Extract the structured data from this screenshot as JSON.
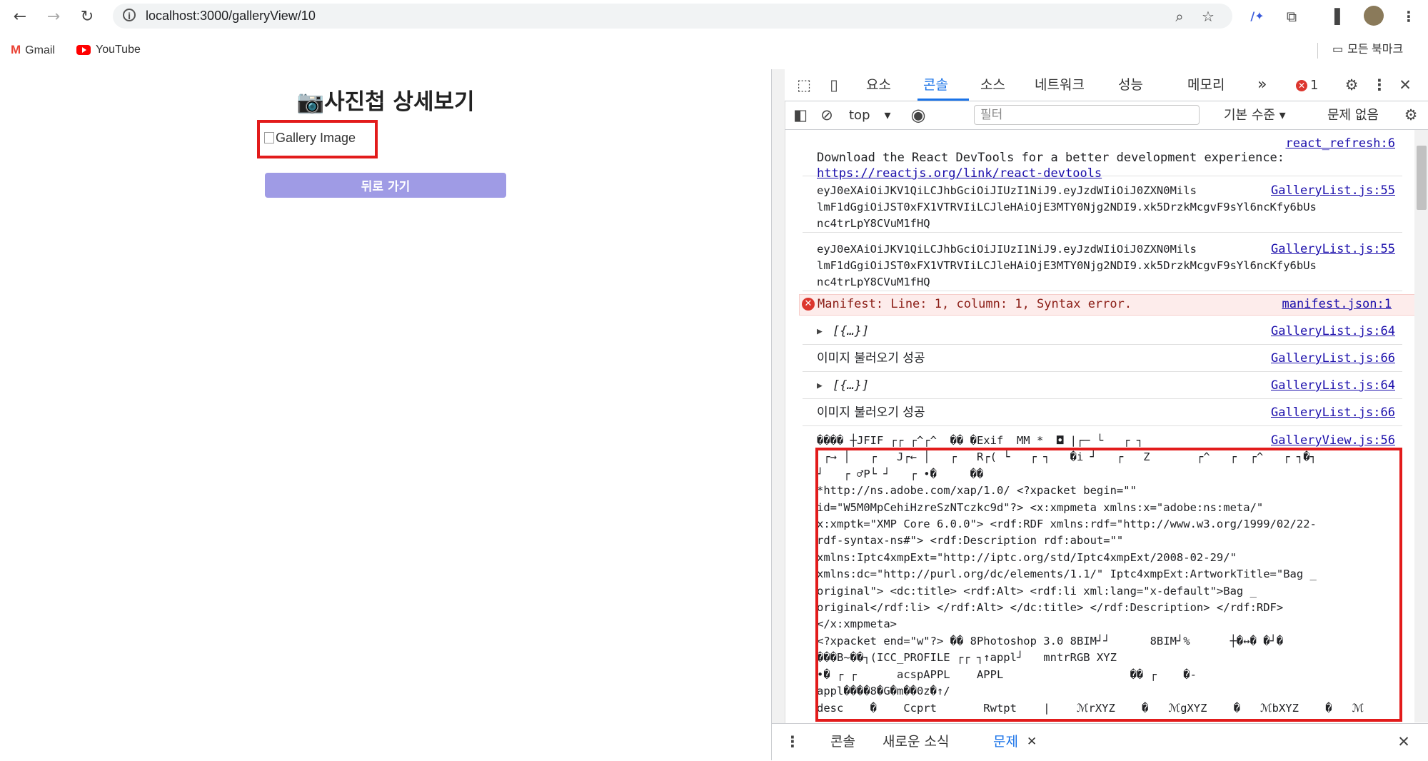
{
  "browser": {
    "url": "localhost:3000/galleryView/10",
    "bookmarks": [
      {
        "label": "Gmail",
        "icon": "gmail-icon"
      },
      {
        "label": "YouTube",
        "icon": "youtube-icon"
      }
    ],
    "all_bookmarks_label": "모든 북마크"
  },
  "page": {
    "title": "📷사진첩 상세보기",
    "image_alt": "Gallery Image",
    "back_button": "뒤로 가기"
  },
  "devtools": {
    "tabs": [
      "요소",
      "콘솔",
      "소스",
      "네트워크",
      "성능",
      "메모리"
    ],
    "active_tab": "콘솔",
    "more_tabs": "»",
    "error_count": "1",
    "context": "top",
    "filter_placeholder": "필터",
    "level": "기본 수준 ▾",
    "issues": "문제 없음",
    "console": {
      "react_src": "react_refresh:6",
      "react_line1": "Download the React DevTools for a better development experience:",
      "react_link": "https://reactjs.org/link/react-devtools",
      "token1_line1": "eyJ0eXAiOiJKV1QiLCJhbGciOiJIUzI1NiJ9.eyJzdWIiOiJ0ZXN0Mils",
      "token1_line2": "lmF1dGgiOiJST0xFX1VTRVIiLCJleHAiOjE3MTY0Njg2NDI9.xk5DrzkMcgvF9sYl6ncKfy6bUs",
      "token1_line3": "nc4trLpY8CVuM1fHQ",
      "token_src": "GalleryList.js:55",
      "error_text": "Manifest: Line: 1, column: 1, Syntax error.",
      "error_src": "manifest.json:1",
      "obj_text": "[{…}]",
      "obj_src": "GalleryList.js:64",
      "success_text": "이미지 불러오기 성공",
      "success_src": "GalleryList.js:66",
      "binary_src": "GalleryView.js:56",
      "binary_lines": [
        "���� ┼JFIF ┌┌ ┌^┌^  �� �Exif  MM *  ◘ |┌─ └   ┌ ┐",
        " ┌→ │   ┌   J┌← │   ┌   R┌( └   ┌ ┐   �i ┘   ┌   Z       ┌^   ┌  ┌^   ┌ ┐�┐",
        "┘   ┌ ♂P└ ┘   ┌ •�     ��",
        "*http://ns.adobe.com/xap/1.0/ <?xpacket begin=\"\"",
        "id=\"W5M0MpCehiHzreSzNTczkc9d\"?> <x:xmpmeta xmlns:x=\"adobe:ns:meta/\"",
        "x:xmptk=\"XMP Core 6.0.0\"> <rdf:RDF xmlns:rdf=\"http://www.w3.org/1999/02/22-",
        "rdf-syntax-ns#\"> <rdf:Description rdf:about=\"\"",
        "xmlns:Iptc4xmpExt=\"http://iptc.org/std/Iptc4xmpExt/2008-02-29/\"",
        "xmlns:dc=\"http://purl.org/dc/elements/1.1/\" Iptc4xmpExt:ArtworkTitle=\"Bag _",
        "original\"> <dc:title> <rdf:Alt> <rdf:li xml:lang=\"x-default\">Bag _",
        "original</rdf:li> </rdf:Alt> </dc:title> </rdf:Description> </rdf:RDF>",
        "</x:xmpmeta>",
        "<?xpacket end=\"w\"?> �� 8Photoshop 3.0 8BIM┘┘      8BIM┘%      ┼�↔� �┘�",
        "���B~��┐(ICC_PROFILE ┌┌ ┐↑appl┘   mntrRGB XYZ",
        "•� ┌ ┌      acspAPPL    APPL                   �� ┌    �-",
        "appl����8�G�m��0z�↑/",
        "desc    �    Ccprt       Rwtpt    |    ℳrXYZ    �   ℳgXYZ    �   ℳbXYZ    �   ℳ"
      ]
    },
    "drawer_tabs": [
      "콘솔",
      "새로운 소식",
      "문제"
    ],
    "drawer_active": "문제"
  }
}
